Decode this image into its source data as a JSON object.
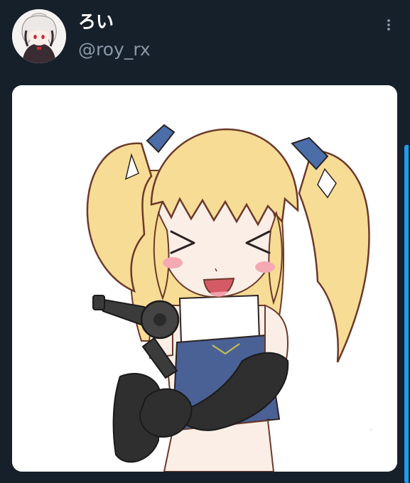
{
  "user": {
    "display_name": "ろい",
    "handle": "@roy_rx"
  },
  "icons": {
    "more": "more-vertical-icon"
  },
  "colors": {
    "background": "#15202b",
    "name_text": "#ffffff",
    "handle_text": "#8b98a5",
    "accent": "#1d9bf0",
    "media_background": "#ffffff"
  }
}
